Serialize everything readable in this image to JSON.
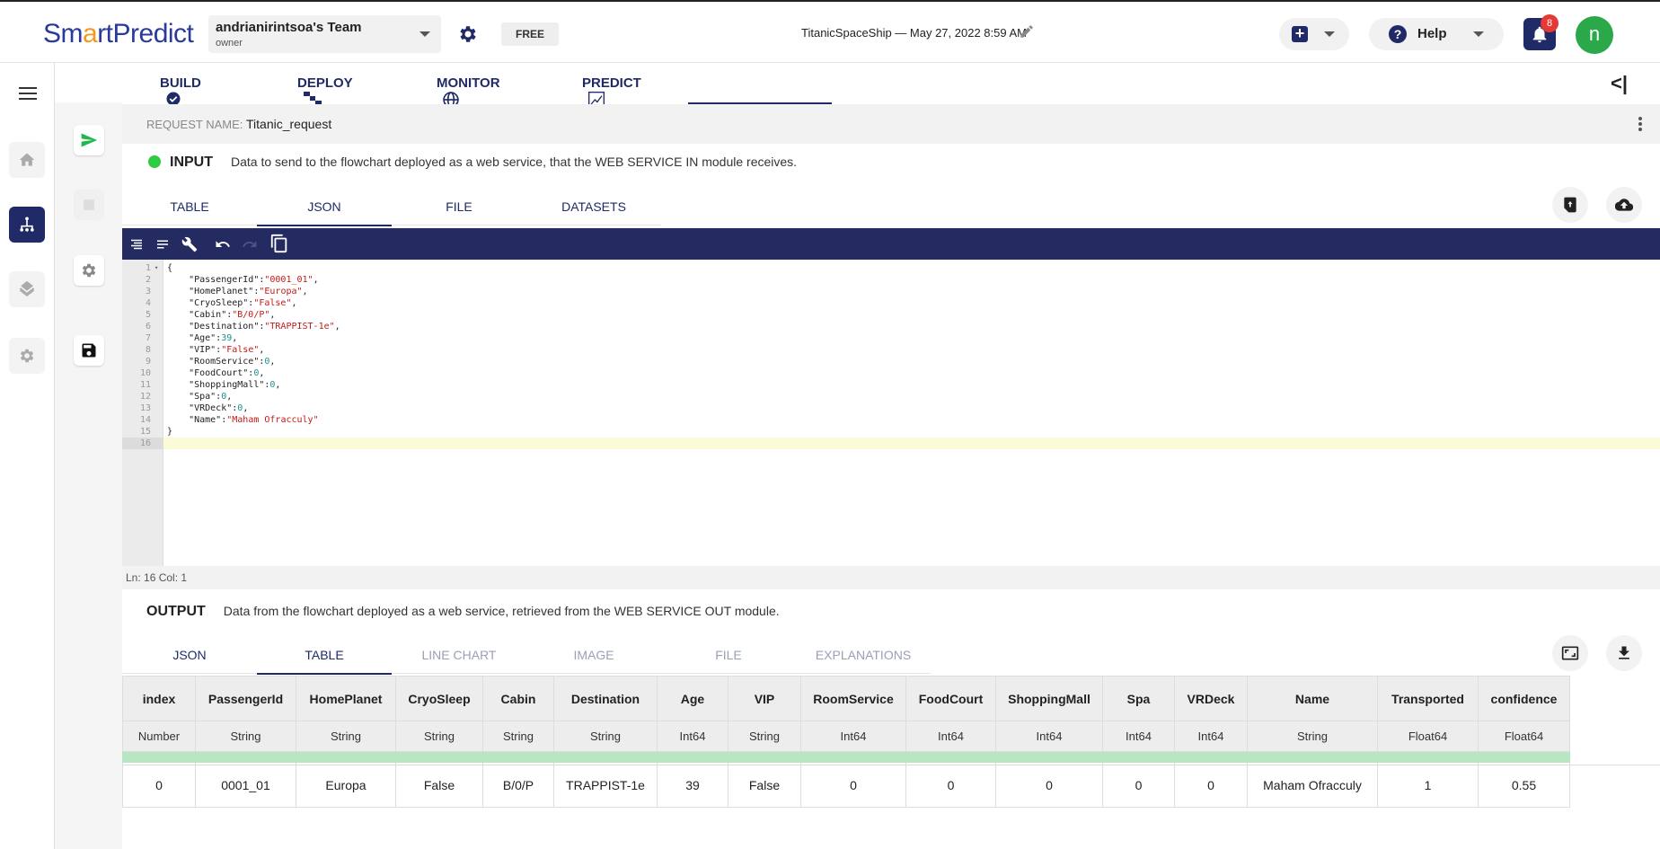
{
  "app": {
    "logo_prefix": "Sm",
    "logo_accent": "a",
    "logo_rest": "rtPredict",
    "team_name": "andrianirintsoa's Team",
    "team_role": "owner",
    "plan_badge": "FREE",
    "project_info": "TitanicSpaceShip — May 27, 2022 8:59 AM",
    "help_label": "Help",
    "notification_count": "8",
    "avatar_initial": "n"
  },
  "main_tabs": [
    {
      "label": "BUILD",
      "icon": "check-circle-icon"
    },
    {
      "label": "DEPLOY",
      "icon": "deploy-icon"
    },
    {
      "label": "MONITOR",
      "icon": "globe-icon"
    },
    {
      "label": "PREDICT",
      "icon": "chart-icon",
      "active": true
    }
  ],
  "request": {
    "label": "REQUEST NAME:",
    "name": "Titanic_request"
  },
  "input": {
    "title": "INPUT",
    "description": "Data to send to the flowchart deployed as a web service, that the WEB SERVICE IN module receives.",
    "tabs": [
      "TABLE",
      "JSON",
      "FILE",
      "DATASETS"
    ],
    "active_tab": "JSON"
  },
  "editor": {
    "lines": [
      {
        "n": "1",
        "parts": [
          [
            "{",
            "p"
          ]
        ],
        "fold": true
      },
      {
        "n": "2",
        "parts": [
          [
            "    \"PassengerId\":",
            "p"
          ],
          [
            "\"0001_01\"",
            "s"
          ],
          [
            ",",
            "p"
          ]
        ]
      },
      {
        "n": "3",
        "parts": [
          [
            "    \"HomePlanet\":",
            "p"
          ],
          [
            "\"Europa\"",
            "s"
          ],
          [
            ",",
            "p"
          ]
        ]
      },
      {
        "n": "4",
        "parts": [
          [
            "    \"CryoSleep\":",
            "p"
          ],
          [
            "\"False\"",
            "s"
          ],
          [
            ",",
            "p"
          ]
        ]
      },
      {
        "n": "5",
        "parts": [
          [
            "    \"Cabin\":",
            "p"
          ],
          [
            "\"B/0/P\"",
            "s"
          ],
          [
            ",",
            "p"
          ]
        ]
      },
      {
        "n": "6",
        "parts": [
          [
            "    \"Destination\":",
            "p"
          ],
          [
            "\"TRAPPIST-1e\"",
            "s"
          ],
          [
            ",",
            "p"
          ]
        ]
      },
      {
        "n": "7",
        "parts": [
          [
            "    \"Age\":",
            "p"
          ],
          [
            "39",
            "n"
          ],
          [
            ",",
            "p"
          ]
        ]
      },
      {
        "n": "8",
        "parts": [
          [
            "    \"VIP\":",
            "p"
          ],
          [
            "\"False\"",
            "s"
          ],
          [
            ",",
            "p"
          ]
        ]
      },
      {
        "n": "9",
        "parts": [
          [
            "    \"RoomService\":",
            "p"
          ],
          [
            "0",
            "n"
          ],
          [
            ",",
            "p"
          ]
        ]
      },
      {
        "n": "10",
        "parts": [
          [
            "    \"FoodCourt\":",
            "p"
          ],
          [
            "0",
            "n"
          ],
          [
            ",",
            "p"
          ]
        ]
      },
      {
        "n": "11",
        "parts": [
          [
            "    \"ShoppingMall\":",
            "p"
          ],
          [
            "0",
            "n"
          ],
          [
            ",",
            "p"
          ]
        ]
      },
      {
        "n": "12",
        "parts": [
          [
            "    \"Spa\":",
            "p"
          ],
          [
            "0",
            "n"
          ],
          [
            ",",
            "p"
          ]
        ]
      },
      {
        "n": "13",
        "parts": [
          [
            "    \"VRDeck\":",
            "p"
          ],
          [
            "0",
            "n"
          ],
          [
            ",",
            "p"
          ]
        ]
      },
      {
        "n": "14",
        "parts": [
          [
            "    \"Name\":",
            "p"
          ],
          [
            "\"Maham Ofracculy\"",
            "s"
          ]
        ]
      },
      {
        "n": "15",
        "parts": [
          [
            "}",
            "p"
          ]
        ]
      },
      {
        "n": "16",
        "parts": [],
        "current": true
      }
    ],
    "status": "Ln: 16    Col: 1"
  },
  "output": {
    "title": "OUTPUT",
    "description": "Data from the flowchart deployed as a web service, retrieved from the WEB SERVICE OUT module.",
    "tabs": [
      {
        "label": "JSON",
        "state": "normal"
      },
      {
        "label": "TABLE",
        "state": "active"
      },
      {
        "label": "LINE CHART",
        "state": "disabled"
      },
      {
        "label": "IMAGE",
        "state": "disabled"
      },
      {
        "label": "FILE",
        "state": "disabled"
      },
      {
        "label": "EXPLANATIONS",
        "state": "disabled"
      }
    ],
    "table": {
      "columns": [
        "index",
        "PassengerId",
        "HomePlanet",
        "CryoSleep",
        "Cabin",
        "Destination",
        "Age",
        "VIP",
        "RoomService",
        "FoodCourt",
        "ShoppingMall",
        "Spa",
        "VRDeck",
        "Name",
        "Transported",
        "confidence"
      ],
      "types": [
        "Number",
        "String",
        "String",
        "String",
        "String",
        "String",
        "Int64",
        "String",
        "Int64",
        "Int64",
        "Int64",
        "Int64",
        "Int64",
        "String",
        "Float64",
        "Float64"
      ],
      "rows": [
        [
          "0",
          "0001_01",
          "Europa",
          "False",
          "B/0/P",
          "TRAPPIST-1e",
          "39",
          "False",
          "0",
          "0",
          "0",
          "0",
          "0",
          "Maham Ofracculy",
          "1",
          "0.55"
        ]
      ]
    }
  },
  "colors": {
    "navy": "#1f2a66",
    "status_green": "#2ecc40",
    "row_green": "#b8e5c2",
    "badge_red": "#e53935"
  }
}
